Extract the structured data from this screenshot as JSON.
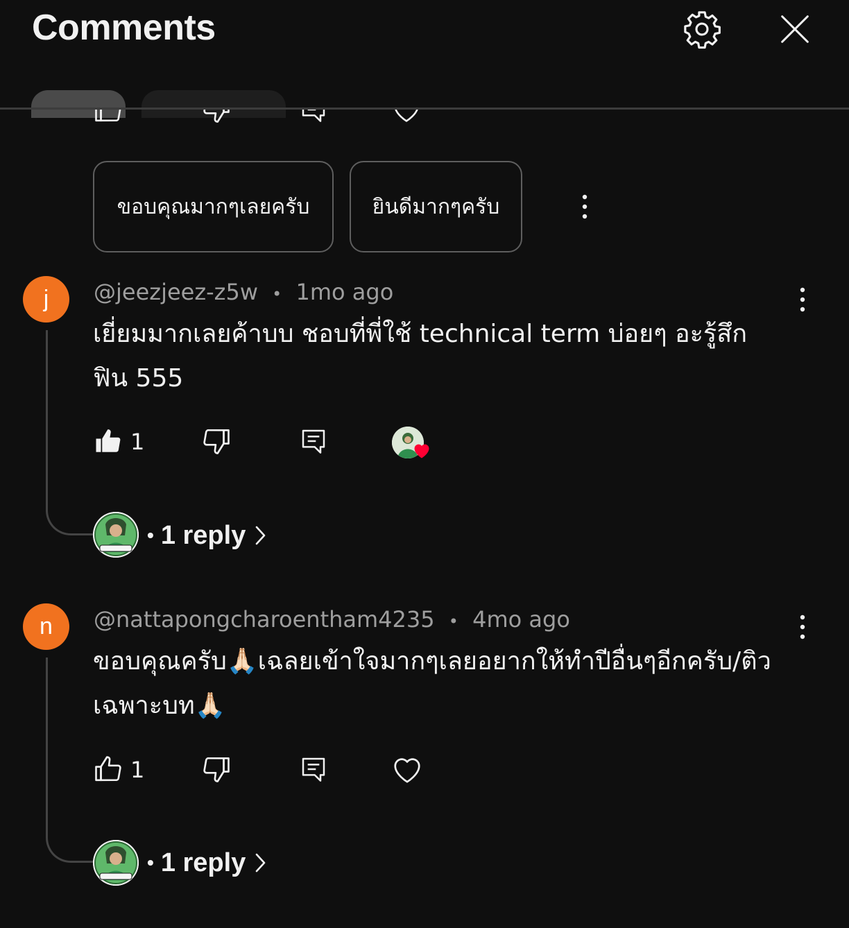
{
  "header": {
    "title": "Comments"
  },
  "chips": [
    "ขอบคุณมากๆเลยครับ",
    "ยินดีมากๆครับ"
  ],
  "comments": [
    {
      "avatar_letter": "j",
      "author": "@jeezjeez-z5w",
      "time": "1mo ago",
      "text": "เยี่ยมมากเลยค้าบบ ชอบที่พี่ใช้ technical term บ่อยๆ อะรู้สึก ฟิน 555",
      "likes": "1",
      "liked": true,
      "creator_hearted": true,
      "replies_label": "1 reply"
    },
    {
      "avatar_letter": "n",
      "author": "@nattapongcharoentham4235",
      "time": "4mo ago",
      "text": "ขอบคุณครับ🙏🏻เฉลยเข้าใจมากๆเลยอยากให้ทำปีอื่นๆอีกครับ/ติวเฉพาะบท🙏🏻",
      "likes": "1",
      "liked": false,
      "creator_hearted": false,
      "replies_label": "1 reply"
    }
  ],
  "meta_separator": "•",
  "reply_separator": "•",
  "colors": {
    "background": "#0f0f0f",
    "avatar_orange": "#f1721f",
    "heart_red": "#ff0033",
    "muted_text": "#9e9e9e"
  },
  "icons": [
    "settings-gear-icon",
    "close-icon",
    "like-icon",
    "dislike-icon",
    "reply-icon",
    "heart-icon",
    "more-vertical-icon",
    "chevron-right-icon"
  ]
}
